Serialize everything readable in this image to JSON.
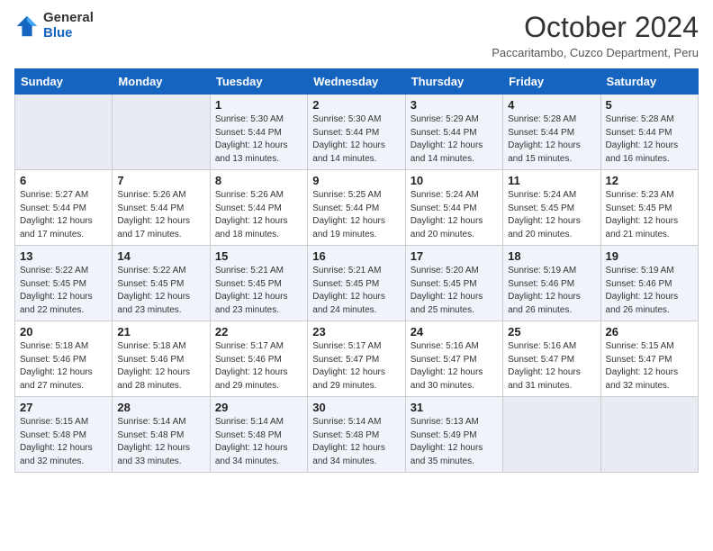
{
  "header": {
    "logo": {
      "general": "General",
      "blue": "Blue"
    },
    "title": "October 2024",
    "subtitle": "Paccaritambo, Cuzco Department, Peru"
  },
  "weekdays": [
    "Sunday",
    "Monday",
    "Tuesday",
    "Wednesday",
    "Thursday",
    "Friday",
    "Saturday"
  ],
  "weeks": [
    [
      {
        "day": "",
        "empty": true
      },
      {
        "day": "",
        "empty": true
      },
      {
        "day": "1",
        "sunrise": "Sunrise: 5:30 AM",
        "sunset": "Sunset: 5:44 PM",
        "daylight": "Daylight: 12 hours and 13 minutes."
      },
      {
        "day": "2",
        "sunrise": "Sunrise: 5:30 AM",
        "sunset": "Sunset: 5:44 PM",
        "daylight": "Daylight: 12 hours and 14 minutes."
      },
      {
        "day": "3",
        "sunrise": "Sunrise: 5:29 AM",
        "sunset": "Sunset: 5:44 PM",
        "daylight": "Daylight: 12 hours and 14 minutes."
      },
      {
        "day": "4",
        "sunrise": "Sunrise: 5:28 AM",
        "sunset": "Sunset: 5:44 PM",
        "daylight": "Daylight: 12 hours and 15 minutes."
      },
      {
        "day": "5",
        "sunrise": "Sunrise: 5:28 AM",
        "sunset": "Sunset: 5:44 PM",
        "daylight": "Daylight: 12 hours and 16 minutes."
      }
    ],
    [
      {
        "day": "6",
        "sunrise": "Sunrise: 5:27 AM",
        "sunset": "Sunset: 5:44 PM",
        "daylight": "Daylight: 12 hours and 17 minutes."
      },
      {
        "day": "7",
        "sunrise": "Sunrise: 5:26 AM",
        "sunset": "Sunset: 5:44 PM",
        "daylight": "Daylight: 12 hours and 17 minutes."
      },
      {
        "day": "8",
        "sunrise": "Sunrise: 5:26 AM",
        "sunset": "Sunset: 5:44 PM",
        "daylight": "Daylight: 12 hours and 18 minutes."
      },
      {
        "day": "9",
        "sunrise": "Sunrise: 5:25 AM",
        "sunset": "Sunset: 5:44 PM",
        "daylight": "Daylight: 12 hours and 19 minutes."
      },
      {
        "day": "10",
        "sunrise": "Sunrise: 5:24 AM",
        "sunset": "Sunset: 5:44 PM",
        "daylight": "Daylight: 12 hours and 20 minutes."
      },
      {
        "day": "11",
        "sunrise": "Sunrise: 5:24 AM",
        "sunset": "Sunset: 5:45 PM",
        "daylight": "Daylight: 12 hours and 20 minutes."
      },
      {
        "day": "12",
        "sunrise": "Sunrise: 5:23 AM",
        "sunset": "Sunset: 5:45 PM",
        "daylight": "Daylight: 12 hours and 21 minutes."
      }
    ],
    [
      {
        "day": "13",
        "sunrise": "Sunrise: 5:22 AM",
        "sunset": "Sunset: 5:45 PM",
        "daylight": "Daylight: 12 hours and 22 minutes."
      },
      {
        "day": "14",
        "sunrise": "Sunrise: 5:22 AM",
        "sunset": "Sunset: 5:45 PM",
        "daylight": "Daylight: 12 hours and 23 minutes."
      },
      {
        "day": "15",
        "sunrise": "Sunrise: 5:21 AM",
        "sunset": "Sunset: 5:45 PM",
        "daylight": "Daylight: 12 hours and 23 minutes."
      },
      {
        "day": "16",
        "sunrise": "Sunrise: 5:21 AM",
        "sunset": "Sunset: 5:45 PM",
        "daylight": "Daylight: 12 hours and 24 minutes."
      },
      {
        "day": "17",
        "sunrise": "Sunrise: 5:20 AM",
        "sunset": "Sunset: 5:45 PM",
        "daylight": "Daylight: 12 hours and 25 minutes."
      },
      {
        "day": "18",
        "sunrise": "Sunrise: 5:19 AM",
        "sunset": "Sunset: 5:46 PM",
        "daylight": "Daylight: 12 hours and 26 minutes."
      },
      {
        "day": "19",
        "sunrise": "Sunrise: 5:19 AM",
        "sunset": "Sunset: 5:46 PM",
        "daylight": "Daylight: 12 hours and 26 minutes."
      }
    ],
    [
      {
        "day": "20",
        "sunrise": "Sunrise: 5:18 AM",
        "sunset": "Sunset: 5:46 PM",
        "daylight": "Daylight: 12 hours and 27 minutes."
      },
      {
        "day": "21",
        "sunrise": "Sunrise: 5:18 AM",
        "sunset": "Sunset: 5:46 PM",
        "daylight": "Daylight: 12 hours and 28 minutes."
      },
      {
        "day": "22",
        "sunrise": "Sunrise: 5:17 AM",
        "sunset": "Sunset: 5:46 PM",
        "daylight": "Daylight: 12 hours and 29 minutes."
      },
      {
        "day": "23",
        "sunrise": "Sunrise: 5:17 AM",
        "sunset": "Sunset: 5:47 PM",
        "daylight": "Daylight: 12 hours and 29 minutes."
      },
      {
        "day": "24",
        "sunrise": "Sunrise: 5:16 AM",
        "sunset": "Sunset: 5:47 PM",
        "daylight": "Daylight: 12 hours and 30 minutes."
      },
      {
        "day": "25",
        "sunrise": "Sunrise: 5:16 AM",
        "sunset": "Sunset: 5:47 PM",
        "daylight": "Daylight: 12 hours and 31 minutes."
      },
      {
        "day": "26",
        "sunrise": "Sunrise: 5:15 AM",
        "sunset": "Sunset: 5:47 PM",
        "daylight": "Daylight: 12 hours and 32 minutes."
      }
    ],
    [
      {
        "day": "27",
        "sunrise": "Sunrise: 5:15 AM",
        "sunset": "Sunset: 5:48 PM",
        "daylight": "Daylight: 12 hours and 32 minutes."
      },
      {
        "day": "28",
        "sunrise": "Sunrise: 5:14 AM",
        "sunset": "Sunset: 5:48 PM",
        "daylight": "Daylight: 12 hours and 33 minutes."
      },
      {
        "day": "29",
        "sunrise": "Sunrise: 5:14 AM",
        "sunset": "Sunset: 5:48 PM",
        "daylight": "Daylight: 12 hours and 34 minutes."
      },
      {
        "day": "30",
        "sunrise": "Sunrise: 5:14 AM",
        "sunset": "Sunset: 5:48 PM",
        "daylight": "Daylight: 12 hours and 34 minutes."
      },
      {
        "day": "31",
        "sunrise": "Sunrise: 5:13 AM",
        "sunset": "Sunset: 5:49 PM",
        "daylight": "Daylight: 12 hours and 35 minutes."
      },
      {
        "day": "",
        "empty": true
      },
      {
        "day": "",
        "empty": true
      }
    ]
  ]
}
